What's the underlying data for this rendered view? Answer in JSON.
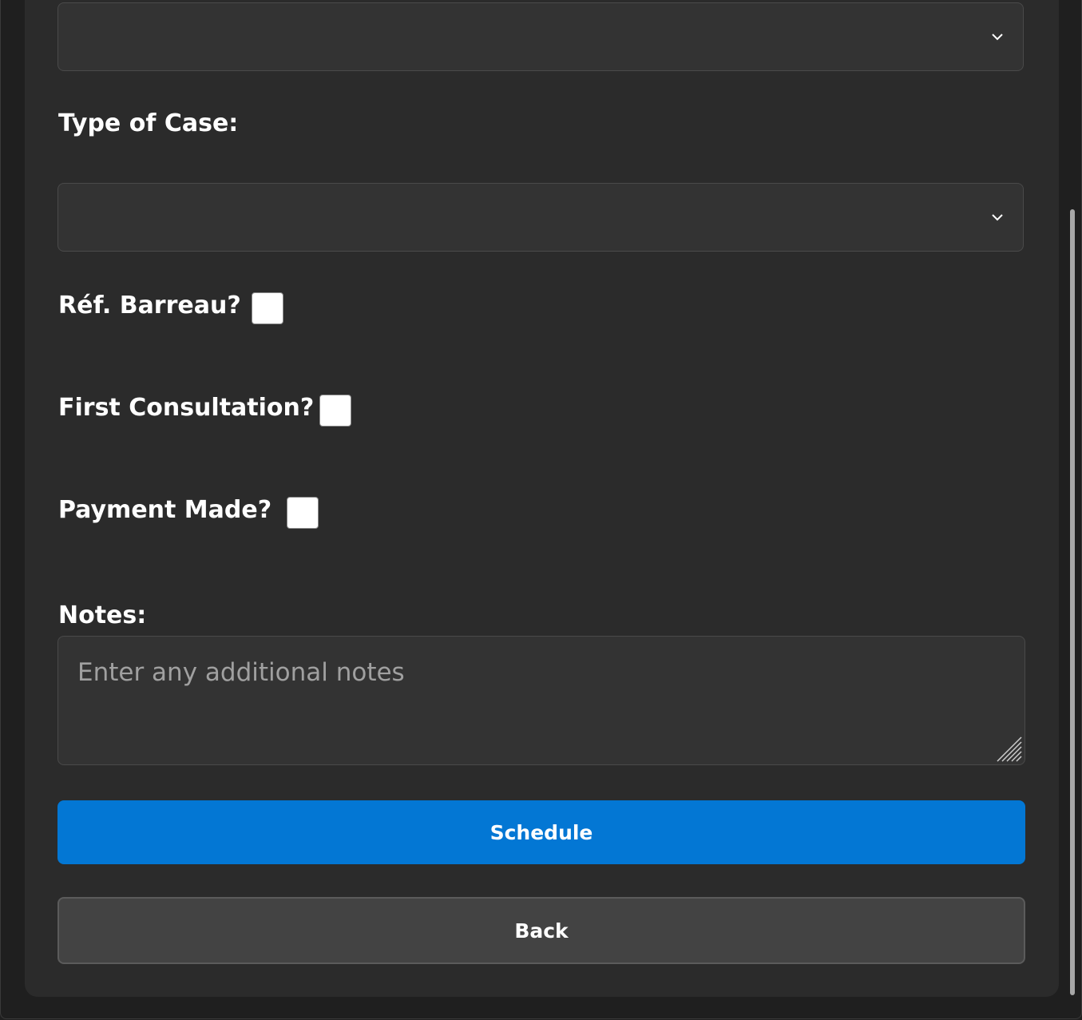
{
  "form": {
    "top_select": {
      "value": "",
      "icon": "chevron-down-icon"
    },
    "case_type": {
      "label": "Type of Case:",
      "value": "",
      "icon": "chevron-down-icon"
    },
    "ref_barreau": {
      "label": "Réf. Barreau?",
      "checked": false
    },
    "first_consultation": {
      "label": "First Consultation?",
      "checked": false
    },
    "payment_made": {
      "label": "Payment Made?",
      "checked": false
    },
    "notes": {
      "label": "Notes:",
      "placeholder": "Enter any additional notes",
      "value": ""
    }
  },
  "actions": {
    "schedule_label": "Schedule",
    "back_label": "Back"
  },
  "colors": {
    "primary": "#0377d4",
    "surface": "#2b2b2b",
    "field": "#333333",
    "secondary_button": "#434343"
  }
}
